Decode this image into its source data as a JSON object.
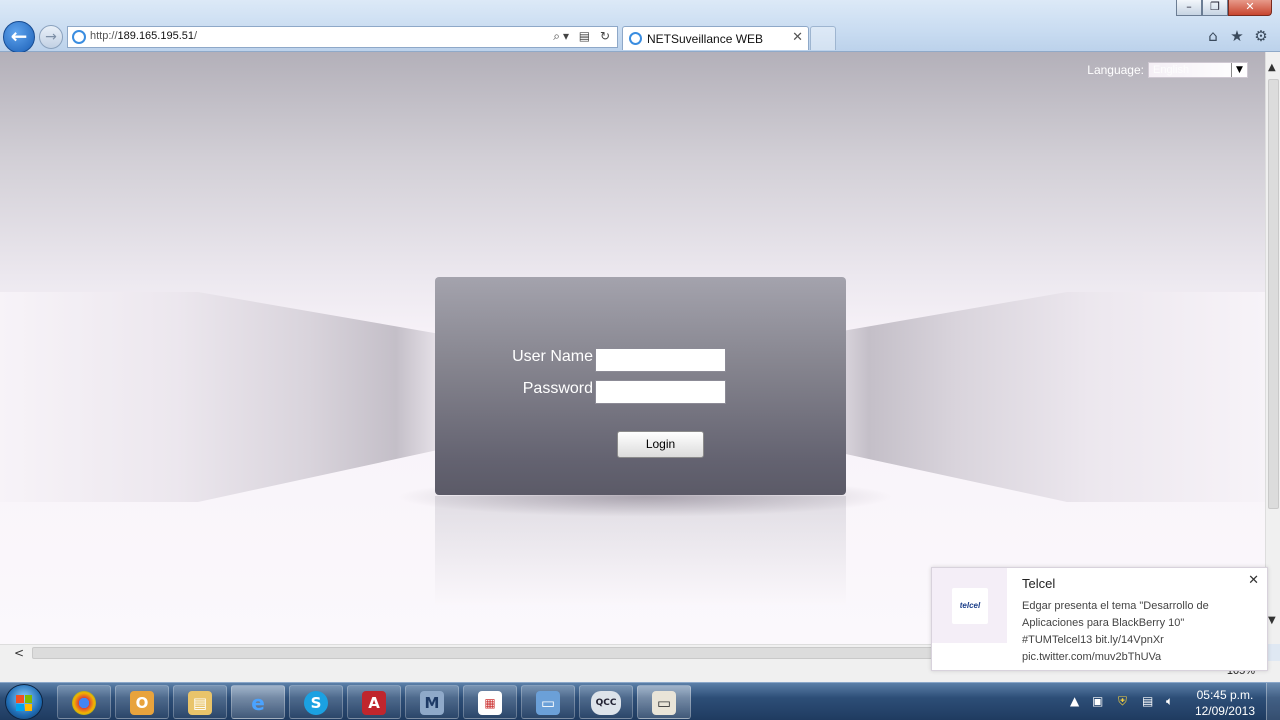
{
  "browser": {
    "url_prefix": "http://",
    "url_host": "189.165.195.51",
    "url_suffix": "/",
    "tab_title": "NETSuveillance WEB",
    "zoom": "105%"
  },
  "page": {
    "language_label": "Language:",
    "language_value": "English",
    "username_label": "User Name",
    "password_label": "Password",
    "username_value": "",
    "password_value": "",
    "login_button": "Login"
  },
  "notification": {
    "title": "Telcel",
    "message": "Edgar presenta el tema \"Desarrollo de Aplicaciones para BlackBerry 10\" #TUMTelcel13 bit.ly/14VpnXr pic.twitter.com/muv2bThUVa",
    "logo_text": "telcel"
  },
  "taskbar": {
    "time": "05:45 p.m.",
    "date": "12/09/2013",
    "apps": [
      "chrome-icon",
      "outlook-icon",
      "file-explorer-icon",
      "internet-explorer-icon",
      "skype-icon",
      "acrobat-icon",
      "m-app-icon",
      "app-grid-icon",
      "photo-viewer-icon",
      "qcc-icon",
      "folder-icon"
    ]
  },
  "colors": {
    "login_box_top": "#a4a3ad",
    "login_box_bottom": "#5b5a67",
    "taskbar": "#2d4e77"
  }
}
